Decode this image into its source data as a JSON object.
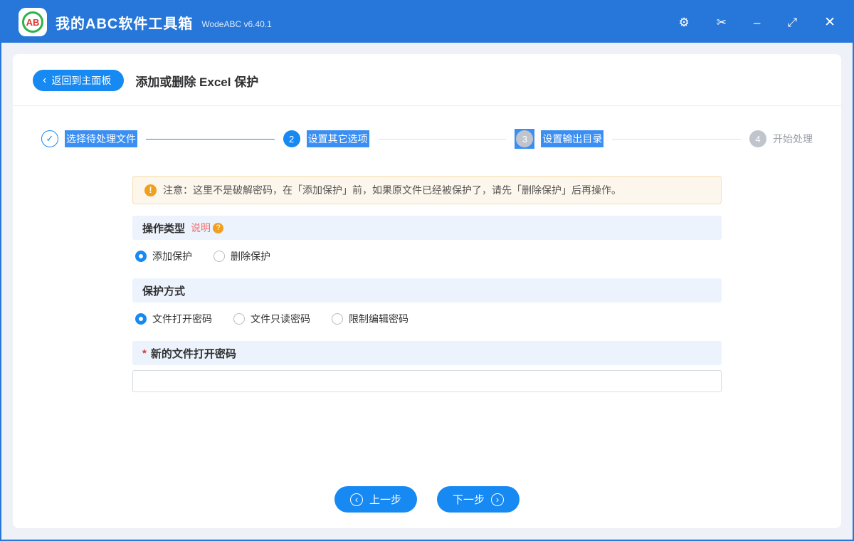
{
  "titlebar": {
    "logo_text": "AB",
    "app_title": "我的ABC软件工具箱",
    "version": "WodeABC v6.40.1",
    "icons": {
      "settings": "⚙",
      "scissors": "✂",
      "minimize": "–",
      "fullscreen": "⤢",
      "close": "✕"
    }
  },
  "header": {
    "back_icon": "‹",
    "back_label": "返回到主面板",
    "page_title": "添加或删除 Excel 保护"
  },
  "steps": [
    {
      "glyph": "✓",
      "label": "选择待处理文件",
      "state": "done",
      "label_highlighted": true
    },
    {
      "glyph": "2",
      "label": "设置其它选项",
      "state": "active",
      "label_highlighted": true
    },
    {
      "glyph": "3",
      "label": "设置输出目录",
      "state": "pending",
      "label_highlighted": true
    },
    {
      "glyph": "4",
      "label": "开始处理",
      "state": "pending",
      "label_highlighted": false
    }
  ],
  "notice": {
    "icon": "!",
    "text": "注意：这里不是破解密码，在「添加保护」前，如果原文件已经被保护了，请先「删除保护」后再操作。"
  },
  "operation_type": {
    "title": "操作类型",
    "help_link": "说明",
    "help_icon": "?",
    "options": [
      {
        "label": "添加保护",
        "selected": true
      },
      {
        "label": "删除保护",
        "selected": false
      }
    ]
  },
  "protection_mode": {
    "title": "保护方式",
    "options": [
      {
        "label": "文件打开密码",
        "selected": true
      },
      {
        "label": "文件只读密码",
        "selected": false
      },
      {
        "label": "限制编辑密码",
        "selected": false
      }
    ]
  },
  "password_field": {
    "required_mark": "*",
    "label": "新的文件打开密码",
    "value": "",
    "placeholder": ""
  },
  "footer": {
    "prev_icon": "‹",
    "prev_label": "上一步",
    "next_icon": "›",
    "next_label": "下一步"
  },
  "colors": {
    "titlebar_blue": "#2677d9",
    "accent_blue": "#1789f2",
    "selection_blue": "#3b8ff3",
    "notice_bg": "#fdf6ec",
    "notice_border": "#f5e0b2",
    "warning_orange": "#f0a020",
    "section_bg": "#edf3fc",
    "link_red": "#f56c6c",
    "inactive_gray": "#c0c4cc"
  }
}
